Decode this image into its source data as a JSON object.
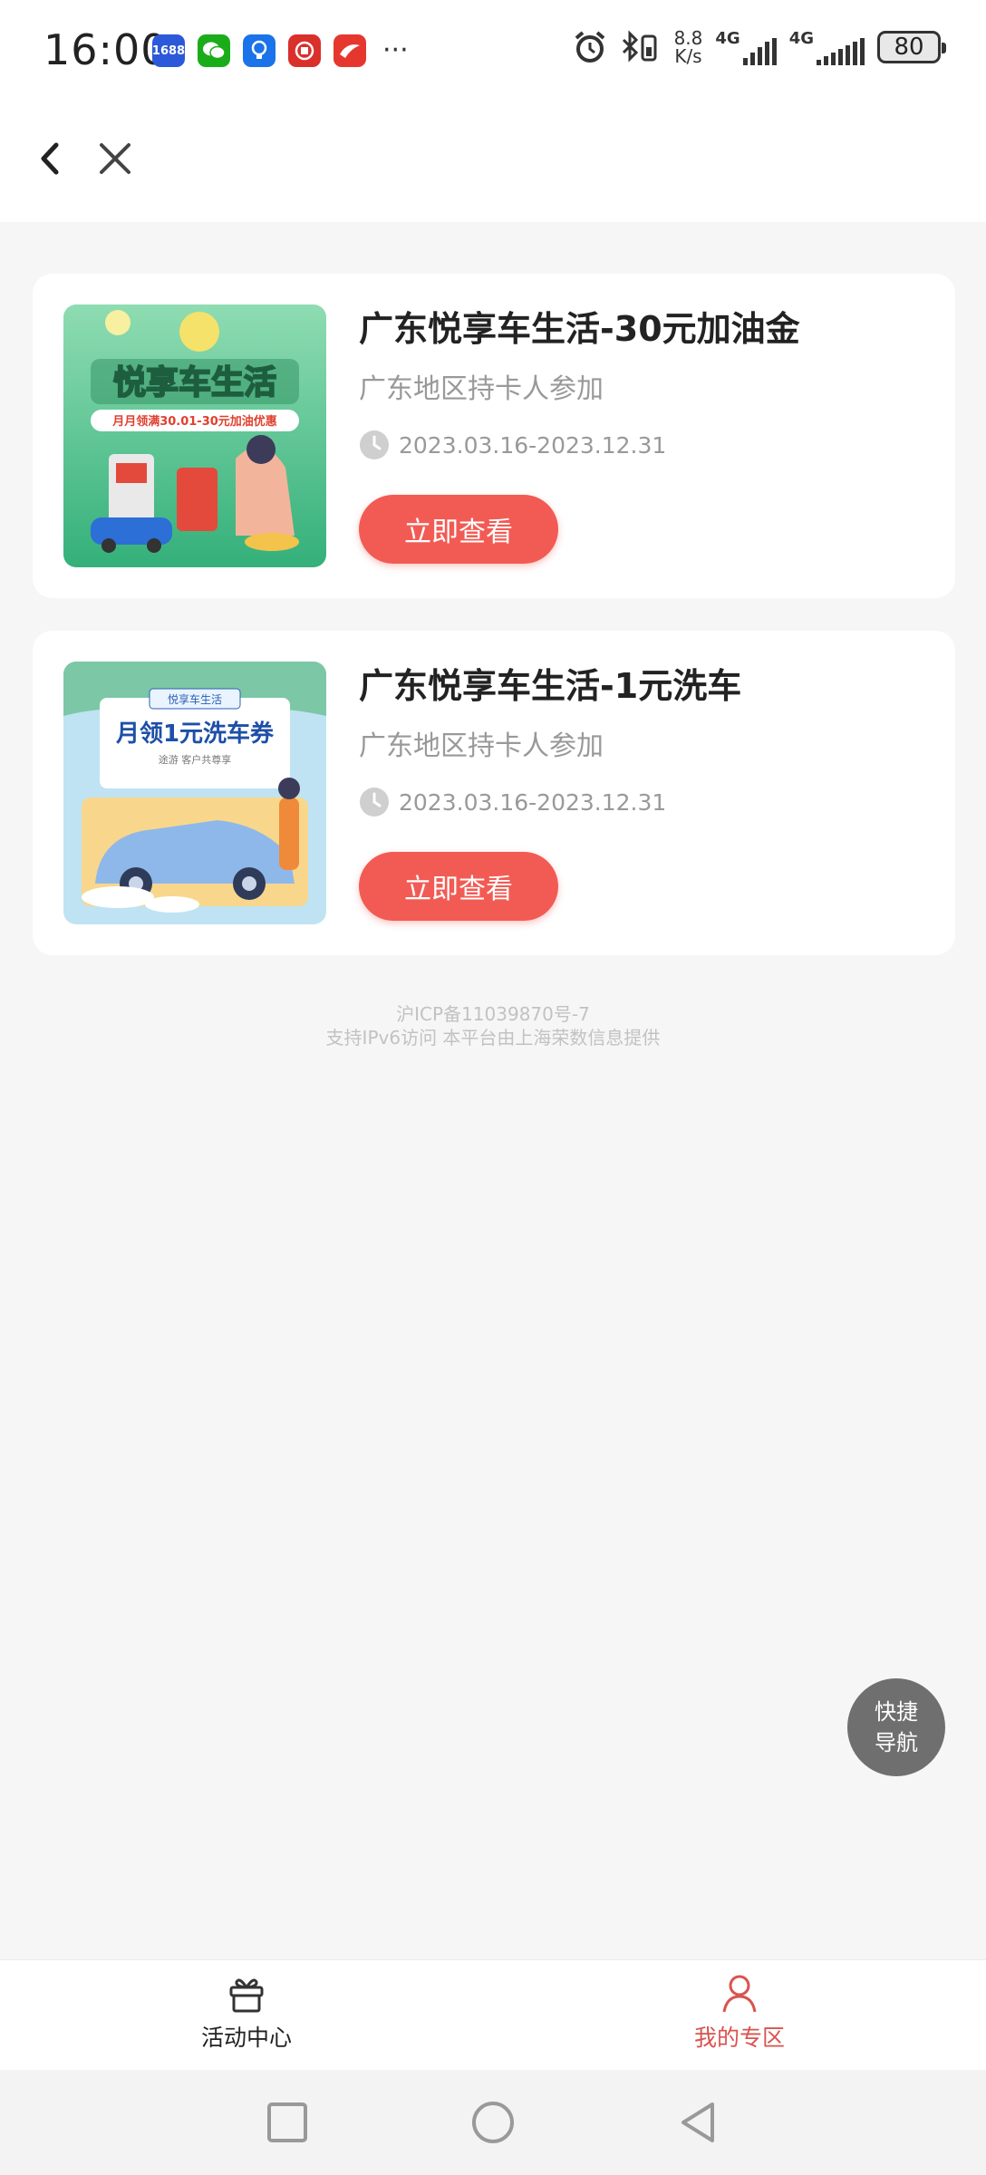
{
  "status_bar": {
    "time": "16:00",
    "app_icons": [
      {
        "name": "1688-app-icon",
        "label": "1688",
        "color": "#2b59d9"
      },
      {
        "name": "wechat-app-icon",
        "label": "",
        "color": "#1aad19"
      },
      {
        "name": "blue-app-icon",
        "label": "",
        "color": "#1a73e8"
      },
      {
        "name": "red-app-icon",
        "label": "",
        "color": "#d9302c"
      },
      {
        "name": "red-bank-app-icon",
        "label": "",
        "color": "#e6372e"
      }
    ],
    "more": "···",
    "net_speed_value": "8.8",
    "net_speed_unit": "K/s",
    "signal1": "4G",
    "signal2": "4G",
    "battery": "80"
  },
  "cards": [
    {
      "title": "广东悦享车生活-30元加油金",
      "subtitle": "广东地区持卡人参加",
      "date": "2023.03.16-2023.12.31",
      "button": "立即查看",
      "thumb_title": "悦享车生活",
      "thumb_tag": "月月领满30.01-30元加油优惠"
    },
    {
      "title": "广东悦享车生活-1元洗车",
      "subtitle": "广东地区持卡人参加",
      "date": "2023.03.16-2023.12.31",
      "button": "立即查看",
      "thumb_title": "悦享车生活",
      "thumb_tag": "月领1元洗车券",
      "thumb_small": "途游 客户共尊享"
    }
  ],
  "footer": {
    "icp": "沪ICP备11039870号-7",
    "support": "支持IPv6访问 本平台由上海荣数信息提供"
  },
  "quick_nav": {
    "line1": "快捷",
    "line2": "导航"
  },
  "tabs": [
    {
      "label": "活动中心",
      "icon": "gift-icon"
    },
    {
      "label": "我的专区",
      "icon": "person-icon",
      "active": true
    }
  ],
  "colors": {
    "accent": "#f25b54",
    "active_tab": "#d9534f"
  }
}
